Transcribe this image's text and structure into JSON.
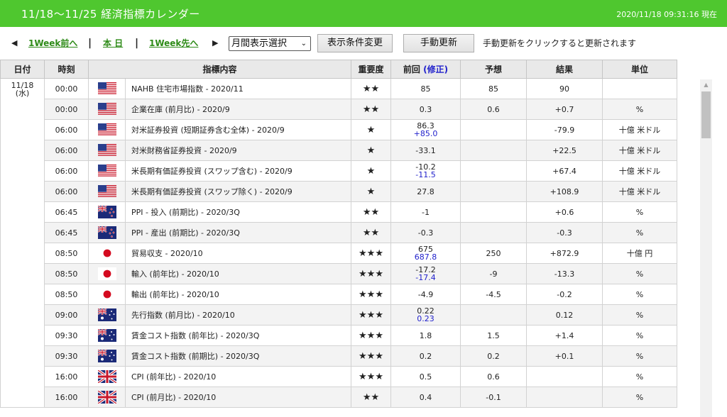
{
  "header": {
    "title": "11/18〜11/25 経済指標カレンダー",
    "timestamp": "2020/11/18 09:31:16 現在"
  },
  "toolbar": {
    "prev_arrow": "◀",
    "prev_week": "1Week前へ",
    "sep1": "|",
    "today": "本 日",
    "sep2": "|",
    "next_week": "1Week先へ",
    "next_arrow": "▶",
    "month_select": "月間表示選択",
    "month_select_caret": "⌄",
    "filter_button": "表示条件変更",
    "refresh_button": "手動更新",
    "refresh_hint": "手動更新をクリックすると更新されます"
  },
  "table": {
    "headers": {
      "date": "日付",
      "time": "時刻",
      "indicator": "指標内容",
      "importance": "重要度",
      "previous": "前回",
      "revised": "(修正)",
      "forecast": "予想",
      "result": "結果",
      "unit": "単位"
    },
    "date": {
      "day": "11/18",
      "weekday": "(水)"
    },
    "rows": [
      {
        "time": "00:00",
        "flag": "us-flag-icon",
        "name": "NAHB 住宅市場指数 - 2020/11",
        "stars": "★★",
        "prev": "85",
        "rev": "",
        "forecast": "85",
        "result": "90",
        "unit": ""
      },
      {
        "time": "00:00",
        "flag": "us-flag-icon",
        "name": "企業在庫 (前月比) - 2020/9",
        "stars": "★★",
        "prev": "0.3",
        "rev": "",
        "forecast": "0.6",
        "result": "+0.7",
        "unit": "%"
      },
      {
        "time": "06:00",
        "flag": "us-flag-icon",
        "name": "対米証券投資 (短期証券含む全体) - 2020/9",
        "stars": "★",
        "prev": "86.3",
        "rev": "+85.0",
        "forecast": "",
        "result": "-79.9",
        "unit": "十億 米ドル"
      },
      {
        "time": "06:00",
        "flag": "us-flag-icon",
        "name": "対米財務省証券投資 - 2020/9",
        "stars": "★",
        "prev": "-33.1",
        "rev": "",
        "forecast": "",
        "result": "+22.5",
        "unit": "十億 米ドル"
      },
      {
        "time": "06:00",
        "flag": "us-flag-icon",
        "name": "米長期有価証券投資 (スワップ含む) - 2020/9",
        "stars": "★",
        "prev": "-10.2",
        "rev": "-11.5",
        "forecast": "",
        "result": "+67.4",
        "unit": "十億 米ドル"
      },
      {
        "time": "06:00",
        "flag": "us-flag-icon",
        "name": "米長期有価証券投資 (スワップ除く) - 2020/9",
        "stars": "★",
        "prev": "27.8",
        "rev": "",
        "forecast": "",
        "result": "+108.9",
        "unit": "十億 米ドル"
      },
      {
        "time": "06:45",
        "flag": "nz-flag-icon",
        "name": "PPI - 投入 (前期比) - 2020/3Q",
        "stars": "★★",
        "prev": "-1",
        "rev": "",
        "forecast": "",
        "result": "+0.6",
        "unit": "%"
      },
      {
        "time": "06:45",
        "flag": "nz-flag-icon",
        "name": "PPI - 産出 (前期比) - 2020/3Q",
        "stars": "★★",
        "prev": "-0.3",
        "rev": "",
        "forecast": "",
        "result": "-0.3",
        "unit": "%"
      },
      {
        "time": "08:50",
        "flag": "jp-flag-icon",
        "name": "貿易収支 - 2020/10",
        "stars": "★★★",
        "prev": "675",
        "rev": "687.8",
        "forecast": "250",
        "result": "+872.9",
        "unit": "十億 円"
      },
      {
        "time": "08:50",
        "flag": "jp-flag-icon",
        "name": "輸入 (前年比) - 2020/10",
        "stars": "★★★",
        "prev": "-17.2",
        "rev": "-17.4",
        "forecast": "-9",
        "result": "-13.3",
        "unit": "%"
      },
      {
        "time": "08:50",
        "flag": "jp-flag-icon",
        "name": "輸出 (前年比) - 2020/10",
        "stars": "★★★",
        "prev": "-4.9",
        "rev": "",
        "forecast": "-4.5",
        "result": "-0.2",
        "unit": "%"
      },
      {
        "time": "09:00",
        "flag": "au-flag-icon",
        "name": "先行指数 (前月比) - 2020/10",
        "stars": "★★★",
        "prev": "0.22",
        "rev": "0.23",
        "forecast": "",
        "result": "0.12",
        "unit": "%"
      },
      {
        "time": "09:30",
        "flag": "au-flag-icon",
        "name": "賃金コスト指数 (前年比) - 2020/3Q",
        "stars": "★★★",
        "prev": "1.8",
        "rev": "",
        "forecast": "1.5",
        "result": "+1.4",
        "unit": "%"
      },
      {
        "time": "09:30",
        "flag": "au-flag-icon",
        "name": "賃金コスト指数 (前期比) - 2020/3Q",
        "stars": "★★★",
        "prev": "0.2",
        "rev": "",
        "forecast": "0.2",
        "result": "+0.1",
        "unit": "%"
      },
      {
        "time": "16:00",
        "flag": "uk-flag-icon",
        "name": "CPI (前年比) - 2020/10",
        "stars": "★★★",
        "prev": "0.5",
        "rev": "",
        "forecast": "0.6",
        "result": "",
        "unit": "%"
      },
      {
        "time": "16:00",
        "flag": "uk-flag-icon",
        "name": "CPI (前月比) - 2020/10",
        "stars": "★★",
        "prev": "0.4",
        "rev": "",
        "forecast": "-0.1",
        "result": "",
        "unit": "%"
      }
    ]
  },
  "scrollbar": {
    "up_arrow": "▲"
  },
  "colors": {
    "header_green": "#4fc72f",
    "link_green": "#2e8b18",
    "revised_blue": "#2222cc"
  }
}
